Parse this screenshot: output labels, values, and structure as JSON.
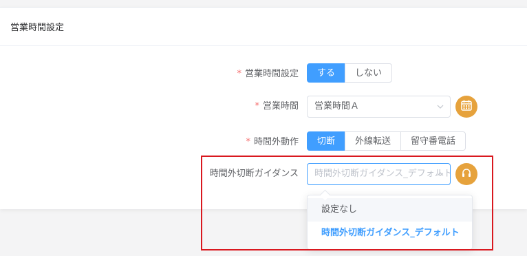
{
  "card": {
    "title": "営業時間設定"
  },
  "form": {
    "business_hours_setting": {
      "label": "営業時間設定",
      "options": [
        "する",
        "しない"
      ],
      "selected": "する"
    },
    "business_hours": {
      "label": "営業時間",
      "value": "営業時間Ａ",
      "action_icon": "calendar-icon"
    },
    "after_hours_action": {
      "label": "時間外動作",
      "options": [
        "切断",
        "外線転送",
        "留守番電話"
      ],
      "selected": "切断"
    },
    "after_hours_guidance": {
      "label": "時間外切断ガイダンス",
      "placeholder": "時間外切断ガイダンス_デフォルト",
      "action_icon": "headphones-icon",
      "dropdown_options": [
        "設定なし",
        "時間外切断ガイダンス_デフォルト"
      ],
      "selected_option": "時間外切断ガイダンス_デフォルト",
      "hovered_option": "設定なし"
    }
  },
  "required_mark": "*",
  "colors": {
    "primary": "#409eff",
    "warning": "#e6a23c",
    "required": "#f56c6c",
    "annotation": "#d9181f"
  }
}
